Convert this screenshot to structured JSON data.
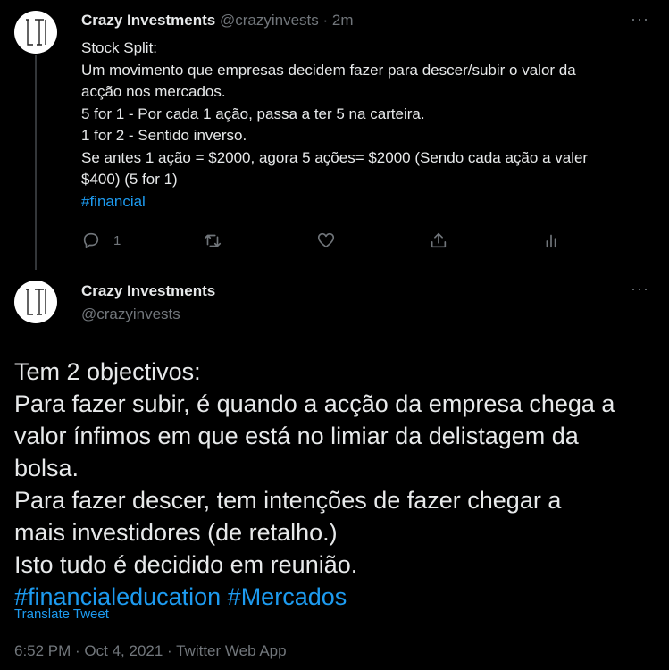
{
  "tweet1": {
    "name": "Crazy Investments",
    "handle": "@crazyinvests",
    "separator": "·",
    "time": "2m",
    "body_lines": [
      "Stock Split:",
      "Um movimento que empresas decidem fazer para descer/subir o valor da",
      "acção nos mercados.",
      "5 for 1 - Por cada 1 ação, passa a ter 5 na carteira.",
      "1 for 2 - Sentido inverso.",
      "Se antes 1 ação = $2000, agora 5 ações= $2000 (Sendo cada ação a valer",
      "$400) (5 for 1)"
    ],
    "hashtag": "#financial",
    "reply_count": "1",
    "more_label": "···"
  },
  "tweet2": {
    "name": "Crazy Investments",
    "handle": "@crazyinvests",
    "more_label": "···",
    "body_lines": [
      "Tem 2 objectivos:",
      "Para fazer subir, é quando a acção da empresa chega a",
      "valor ínfimos em que está no limiar da delistagem da",
      "bolsa.",
      "Para fazer descer, tem intenções de fazer chegar a",
      "mais investidores (de retalho.)",
      "Isto tudo é decidido em reunião."
    ],
    "hashtags": "#financialeducation #Mercados",
    "translate_label": "Translate Tweet",
    "meta": "6:52 PM · Oct 4, 2021 · Twitter Web App"
  },
  "avatar": {
    "logo": "CI-logo"
  },
  "colors": {
    "link": "#1d9bf0",
    "muted": "#71767b",
    "text": "#e7e9ea",
    "background": "#000000"
  }
}
